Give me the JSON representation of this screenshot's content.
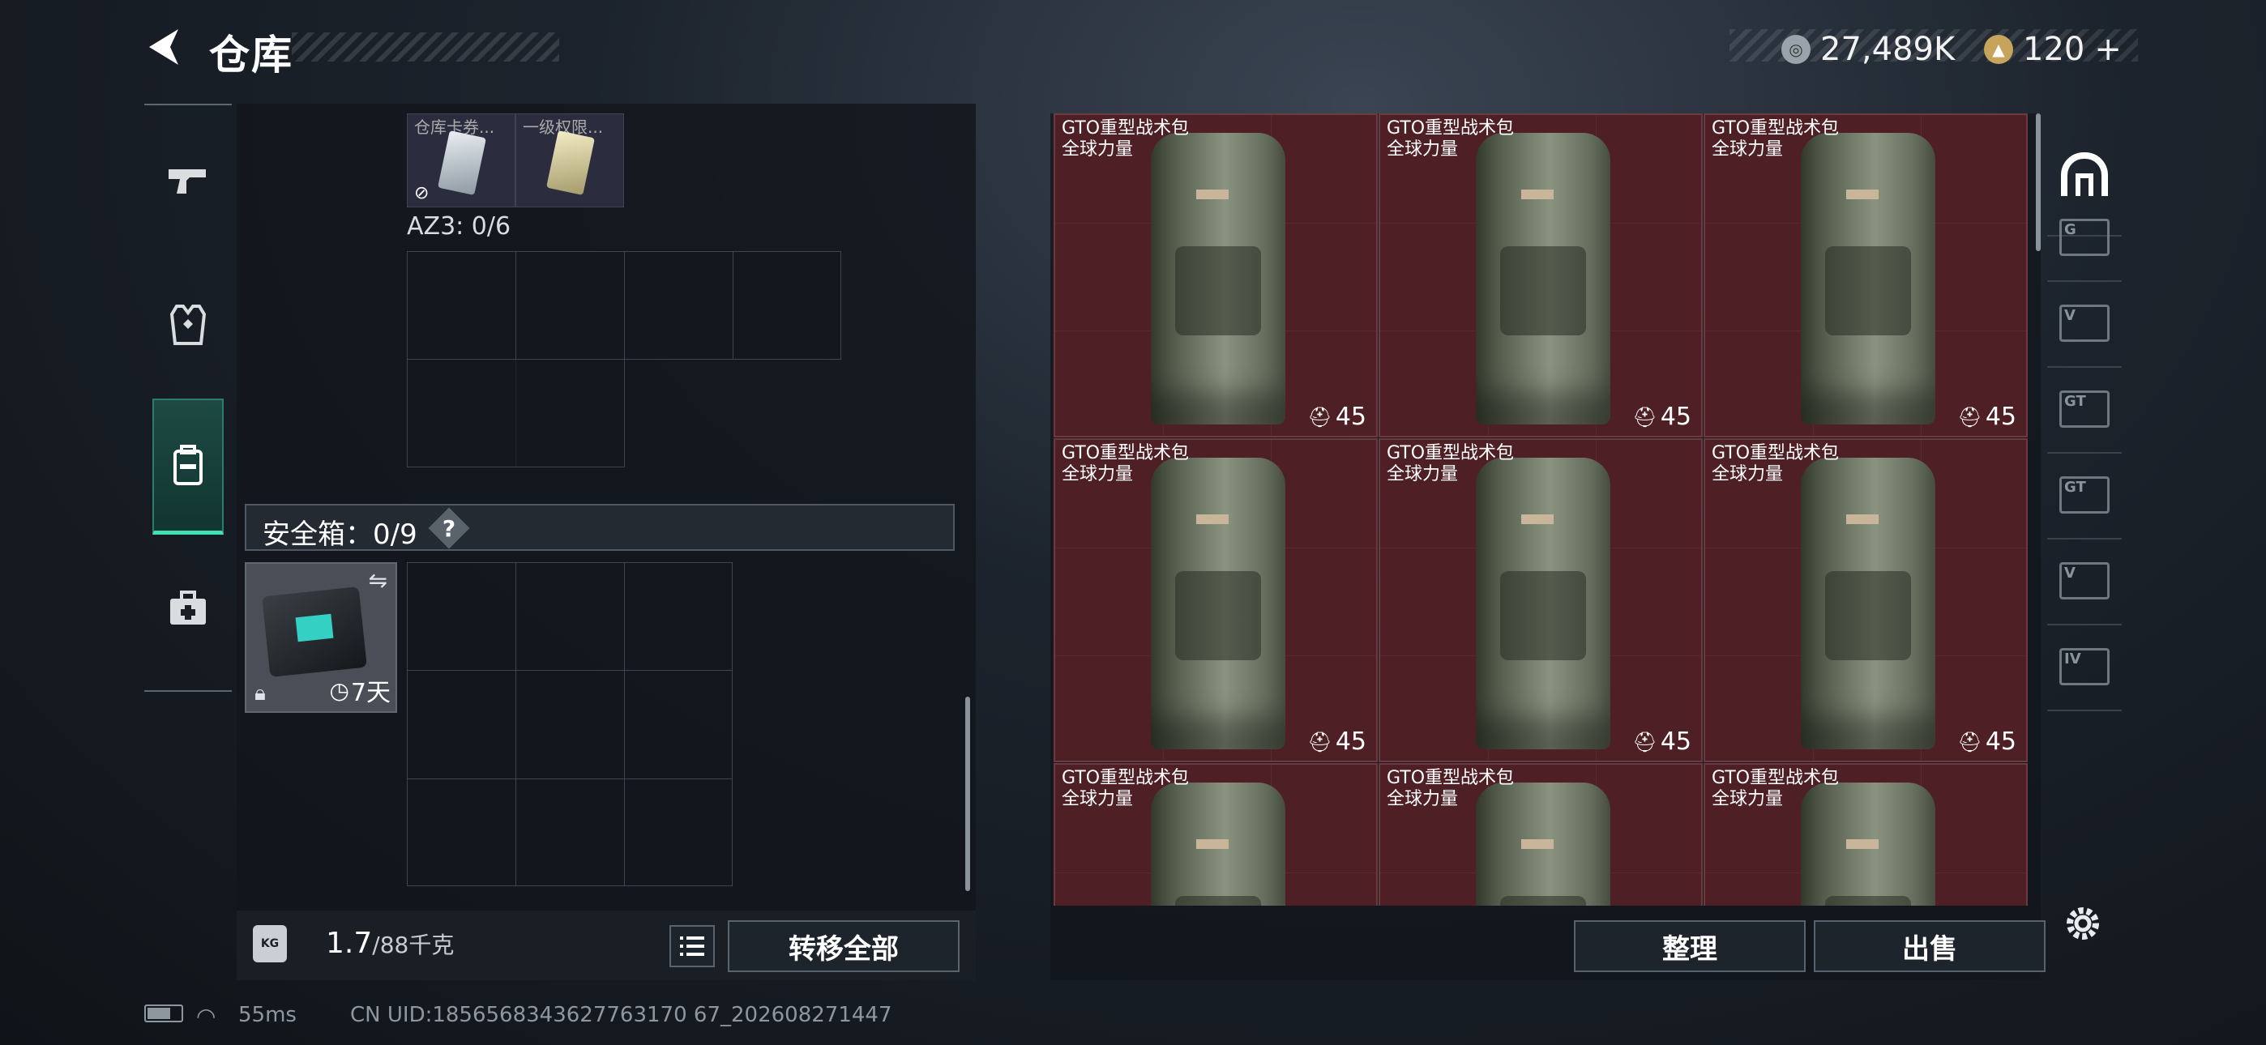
{
  "header": {
    "title": "仓库",
    "currency_silver": "27,489K",
    "currency_gold": "120",
    "gold_plus": "+"
  },
  "left_nav": {
    "items": [
      {
        "name": "weapons",
        "icon": "pistol-icon"
      },
      {
        "name": "armor",
        "icon": "vest-icon"
      },
      {
        "name": "backpack",
        "icon": "backpack-icon",
        "active": true
      },
      {
        "name": "medical",
        "icon": "medkit-icon"
      }
    ]
  },
  "container": {
    "top_items": [
      "仓库卡券...",
      "一级权限..."
    ],
    "az3_label": "AZ3: 0/6"
  },
  "safe_box": {
    "label": "安全箱：0/9",
    "help": "?",
    "duration": "7天"
  },
  "bottom_left": {
    "weight_current": "1.7",
    "weight_max": "/88千克",
    "transfer_all": "转移全部"
  },
  "items": [
    {
      "name": "GTO重型战术包",
      "source": "全球力量",
      "count": "45"
    },
    {
      "name": "GTO重型战术包",
      "source": "全球力量",
      "count": "45"
    },
    {
      "name": "GTO重型战术包",
      "source": "全球力量",
      "count": "45"
    },
    {
      "name": "GTO重型战术包",
      "source": "全球力量",
      "count": "45"
    },
    {
      "name": "GTO重型战术包",
      "source": "全球力量",
      "count": "45"
    },
    {
      "name": "GTO重型战术包",
      "source": "全球力量",
      "count": "45"
    },
    {
      "name": "GTO重型战术包",
      "source": "全球力量",
      "count": ""
    },
    {
      "name": "GTO重型战术包",
      "source": "全球力量",
      "count": ""
    },
    {
      "name": "GTO重型战术包",
      "source": "全球力量",
      "count": ""
    }
  ],
  "right_categories": [
    {
      "name": "all",
      "icon": "helmet-icon",
      "active": true
    },
    {
      "name": "g-lock",
      "icon": "weapon-g-icon"
    },
    {
      "name": "v-cam",
      "icon": "weapon-v-icon"
    },
    {
      "name": "gt-a",
      "icon": "weapon-gt-icon"
    },
    {
      "name": "gt-b",
      "icon": "weapon-gt2-icon"
    },
    {
      "name": "v-b",
      "icon": "weapon-v2-icon"
    },
    {
      "name": "iv",
      "icon": "weapon-iv-icon"
    }
  ],
  "bottom_right": {
    "sort": "整理",
    "sell": "出售"
  },
  "status": {
    "ping": "55ms",
    "uid": "CN UID:1856568343627763170 67_202608271447"
  }
}
